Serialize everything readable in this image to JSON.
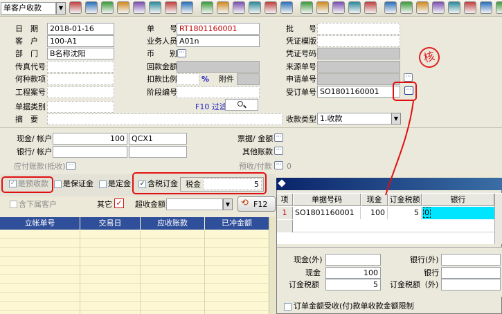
{
  "toolbar": {
    "doc_type_value": "单客户收款",
    "icons": [
      "grid-icon",
      "save-icon",
      "globe-icon",
      "lock-icon",
      "folder-icon",
      "book-icon",
      "image-icon",
      "puzzle-icon",
      "help-icon",
      "email-icon",
      "wrench-icon",
      "dollar-icon",
      "cart-icon",
      "truck-icon",
      "copy-icon",
      "paste-icon",
      "pages-icon",
      "stack-icon",
      "check-icon",
      "shield-icon",
      "history-icon",
      "print-preview-icon",
      "tree-icon",
      "report-icon",
      "square-icon",
      "close-box-icon",
      "checkbox-icon"
    ]
  },
  "header": {
    "date_label": "日　期",
    "date_value": "2018-01-16",
    "customer_label": "客　户",
    "customer_value": "100-A1",
    "dept_label": "部　门",
    "dept_value": "B名称沈阳",
    "fax_label": "传真代号",
    "payment_method_label": "何种款项",
    "project_label": "工程案号",
    "doc_category_label": "单据类别",
    "summary_label": "摘　要",
    "doc_no_label": "单　　号",
    "doc_no_value": "RT1801160001",
    "salesperson_label": "业务人员",
    "salesperson_value": "A01n",
    "currency_label": "币　　别",
    "return_amount_label": "回款金额",
    "discount_label": "扣款比例",
    "percent_symbol": "%",
    "attachment_label": "附件",
    "stage_label": "阶段编号",
    "filter_label": "F10 过滤",
    "batch_label": "批　　号",
    "voucher_template_label": "凭证模版",
    "voucher_no_label": "凭证号码",
    "source_no_label": "来源单号",
    "request_no_label": "申请单号",
    "order_no_label": "受订单号",
    "order_no_value": "SO1801160001",
    "receipt_type_label": "收款类型",
    "receipt_type_value": "1.收款",
    "stamp_text": "核"
  },
  "payment": {
    "cash_label": "现金/ 帐户",
    "cash_amount": "100",
    "cash_account": "QCX1",
    "bank_label": "银行/ 帐户",
    "receivable_offset_label": "应付账款(抵收)",
    "bill_label": "票据/ 金额",
    "other_label": "其他账款",
    "prepay_label": "预收/付款",
    "prepay_value": "0"
  },
  "options": {
    "prepaid_label": "是预收款",
    "deposit_label": "是保证金",
    "fixed_deposit_label": "是定金",
    "tax_deposit_label": "含税订金",
    "tax_label": "税金",
    "tax_value": "5",
    "exclude_sub_label": "含下属客户",
    "other_label": "其它",
    "over_amount_label": "超收金额",
    "f12_label": "F12"
  },
  "left_table": {
    "columns": [
      "立帐单号",
      "交易日",
      "应收账款",
      "已冲金额"
    ]
  },
  "right_table": {
    "columns": [
      "项",
      "单据号码",
      "现金",
      "订金税额",
      "银行"
    ],
    "rows": [
      {
        "index": "1",
        "doc_no": "SO1801160001",
        "cash": "100",
        "tax": "5",
        "bank": "0"
      }
    ]
  },
  "right_summary": {
    "cash_foreign_label": "现金(外)",
    "bank_foreign_label": "银行(外)",
    "cash_label": "现金",
    "cash_value": "100",
    "bank_label": "银行",
    "tax_label": "订金税额",
    "tax_value": "5",
    "tax_foreign_label": "订金税额（外)",
    "limit_label": "订单金额受收(付)款单收款金额限制"
  }
}
